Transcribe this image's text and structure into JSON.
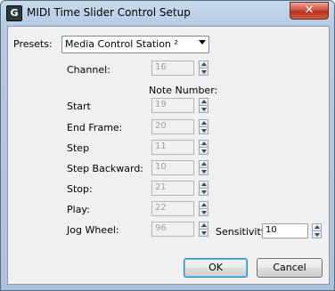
{
  "window": {
    "title": "MIDI Time Slider Control Setup",
    "app_icon_glyph": "G",
    "close_glyph": "✕"
  },
  "presets": {
    "label": "Presets:",
    "selected": "Media Control Station ²"
  },
  "fields": {
    "channel": {
      "label": "Channel:",
      "value": "16"
    },
    "note_number_header": "Note Number:",
    "start": {
      "label": "Start",
      "value": "19"
    },
    "end_frame": {
      "label": "End Frame:",
      "value": "20"
    },
    "step": {
      "label": "Step",
      "value": "11"
    },
    "step_backward": {
      "label": "Step Backward:",
      "value": "10"
    },
    "stop": {
      "label": "Stop:",
      "value": "21"
    },
    "play": {
      "label": "Play:",
      "value": "22"
    },
    "jog_wheel": {
      "label": "Jog Wheel:",
      "value": "96"
    },
    "sensitivity": {
      "label": "Sensitivity:",
      "value": "10"
    }
  },
  "buttons": {
    "ok": "OK",
    "cancel": "Cancel"
  },
  "colors": {
    "title_bar": "#b5cbe2",
    "close_button": "#d4533d",
    "dialog_background": "#f0f0f0",
    "default_button_border": "#3c7fb1"
  }
}
